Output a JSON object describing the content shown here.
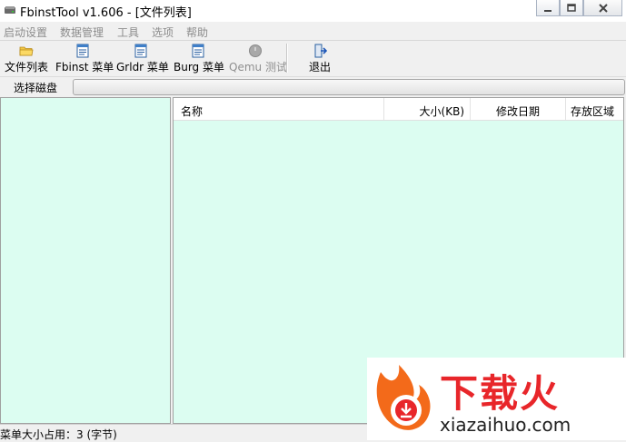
{
  "window": {
    "title": "FbinstTool v1.606 - [文件列表]",
    "icons": {
      "app": "drive-icon",
      "minimize": "minimize-icon",
      "maximize": "maximize-icon",
      "close": "close-icon"
    }
  },
  "menubar": {
    "items": [
      {
        "label": "启动设置"
      },
      {
        "label": "数据管理"
      },
      {
        "label": "工具"
      },
      {
        "label": "选项"
      },
      {
        "label": "帮助"
      }
    ]
  },
  "toolbar": {
    "buttons": [
      {
        "label": "文件列表",
        "icon": "folder-icon",
        "enabled": true
      },
      {
        "label": "Fbinst 菜单",
        "icon": "document-icon",
        "enabled": true
      },
      {
        "label": "Grldr 菜单",
        "icon": "document-icon",
        "enabled": true
      },
      {
        "label": "Burg 菜单",
        "icon": "document-icon",
        "enabled": true
      },
      {
        "label": "Qemu 测试",
        "icon": "circle-icon",
        "enabled": false
      },
      {
        "label": "退出",
        "icon": "exit-icon",
        "enabled": true
      }
    ]
  },
  "disk_bar": {
    "label": "选择磁盘",
    "selected": ""
  },
  "file_list": {
    "columns": [
      "名称",
      "大小(KB)",
      "修改日期",
      "存放区域"
    ],
    "rows": []
  },
  "status": {
    "text": "菜单大小占用：3 (字节)"
  },
  "watermark": {
    "text_cn": "下载火",
    "text_en": "xiazaihuo.com"
  },
  "colors": {
    "pane_background": "#dcfdf1",
    "watermark_red": "#e8262a",
    "disabled_text": "#8c8c8c"
  }
}
